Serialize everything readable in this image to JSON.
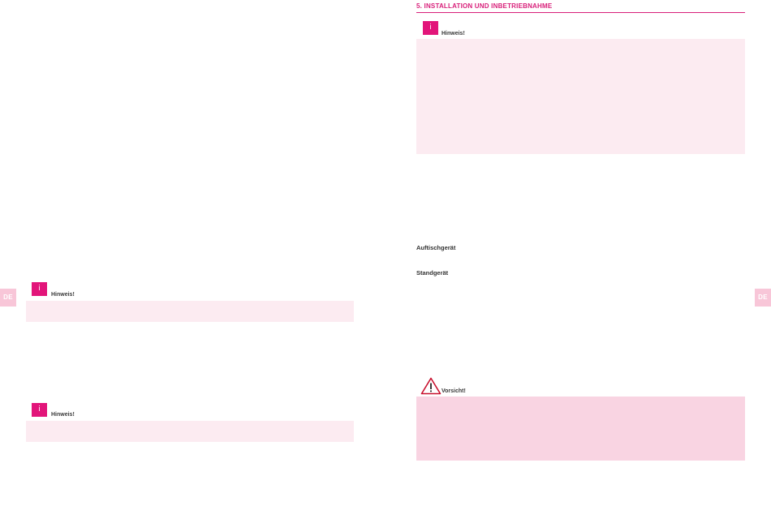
{
  "lang_tab": "DE",
  "section": {
    "number": "5.",
    "title": "INSTALLATION UND INBETRIEBNAHME"
  },
  "notes": {
    "hint_label": "Hinweis!",
    "caution_label": "Vorsicht!"
  },
  "devices": {
    "countertop": "Auftischgerät",
    "floor": "Standgerät"
  },
  "colors": {
    "accent": "#e2157a",
    "note_bg": "#fcebf1",
    "caution_bg": "#f9d4e2",
    "lang_tab_bg": "#f8c6d8"
  }
}
